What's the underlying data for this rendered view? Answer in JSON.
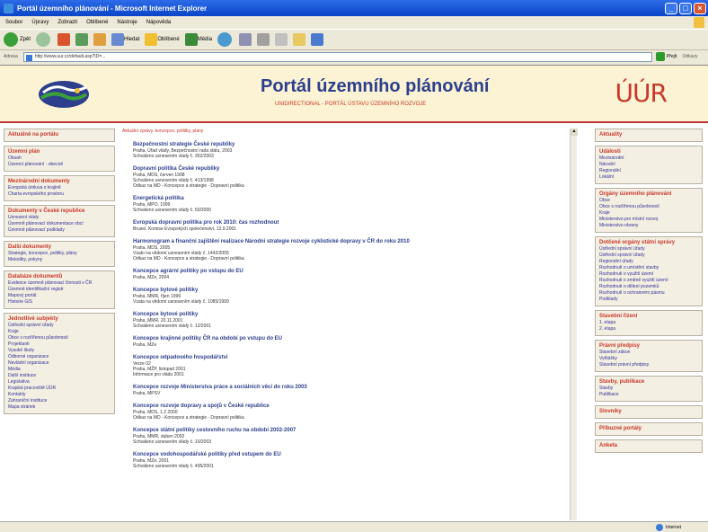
{
  "window": {
    "title": "Portál územního plánování - Microsoft Internet Explorer"
  },
  "menu": [
    "Soubor",
    "Úpravy",
    "Zobrazit",
    "Oblíbené",
    "Nástroje",
    "Nápověda"
  ],
  "toolbar": {
    "back": "Zpět",
    "search": "Hledat",
    "favorites": "Oblíbené",
    "media": "Média"
  },
  "address": {
    "label": "Adresa",
    "url": "http://www.uur.cz/default.asp?ID=...",
    "go": "Přejít",
    "links": "Odkazy"
  },
  "header": {
    "title": "Portál územního plánování",
    "subtitle": "UNIDIRECTIONAL - PORTÁL ÚSTAVU ÚZEMNÍHO ROZVOJE",
    "uur": "ÚÚR"
  },
  "left": [
    {
      "head": "Aktuálně na portálu",
      "items": []
    },
    {
      "head": "Územní plán",
      "items": [
        "Obsah",
        "Územní plánování - obecně"
      ]
    },
    {
      "head": "Mezinárodní dokumenty",
      "items": [
        "Evropská úmluva o krajině",
        "Charta evropského prostoru"
      ]
    },
    {
      "head": "Dokumenty v České republice",
      "items": [
        "Usnesení vlády",
        "Územně plánovací dokumentace obcí",
        "Územně plánovací podklady"
      ]
    },
    {
      "head": "Další dokumenty",
      "items": [
        "Strategie, koncepce, politiky, plány",
        "Metodiky, pokyny"
      ]
    },
    {
      "head": "Databáze dokumentů",
      "items": [
        "Evidence územně plánovací činnosti v ČR",
        "Územně identifikační registr",
        "Mapový portál",
        "Historie GIS"
      ]
    },
    {
      "head": "Jednotlivé subjekty",
      "items": [
        "Ústřední správní úřady",
        "Kraje",
        "Obce s rozšířenou působností",
        "Projektanti",
        "Vysoké školy",
        "Odborné organizace",
        "Nevládní organizace",
        "Média",
        "Další instituce",
        "Legislativa",
        "Krajská pracoviště ÚÚR",
        "Kontakty",
        "Zahraniční instituce",
        "Mapa stránek"
      ]
    }
  ],
  "breadcrumb": "Aktuální zprávy, koncepce, politiky, plány",
  "entries": [
    {
      "title": "Bezpečnostní strategie České republiky",
      "lines": [
        "Praha, Úřad vlády, Bezpečnostní rada státu, 2003",
        "Schváleno usnesením vlády č. 352/2003"
      ]
    },
    {
      "title": "Dopravní politika České republiky",
      "lines": [
        "Praha, MDS, červen 1998",
        "Schváleno usnesením vlády č. 413/1998",
        "Odkaz na MD - Koncepce a strategie - Dopravní politika"
      ]
    },
    {
      "title": "Energetická politika",
      "lines": [
        "Praha, MPO, 1999",
        "Schváleno usnesením vlády č. 50/2000"
      ]
    },
    {
      "title": "Evropská dopravní politika pro rok 2010: čas rozhodnout",
      "lines": [
        "Brusel, Komise Evropských společenství, 12.9.2001"
      ]
    },
    {
      "title": "Harmonogram a finanční zajištění realizace Národní strategie rozvoje cyklistické dopravy v ČR do roku 2010",
      "lines": [
        "Praha, MDS, 2005",
        "Vzato na vědomí usnesením vlády č. 1442/2005",
        "Odkaz na MD - Koncepce a strategie - Dopravní politika"
      ]
    },
    {
      "title": "Koncepce agrární politiky po vstupu do EU",
      "lines": [
        "Praha, MZe, 2004"
      ]
    },
    {
      "title": "Koncepce bytové politiky",
      "lines": [
        "Praha, MMR, říjen 1999",
        "Vzata na vědomí usnesením vlády č. 1085/1999"
      ]
    },
    {
      "title": "Koncepce bytové politiky",
      "lines": [
        "Praha, MMR, 20.11.2001",
        "Schváleno usnesením vlády č. 12/2001"
      ]
    },
    {
      "title": "Koncepce krajinné politiky ČR na období po vstupu do EU",
      "lines": [
        "Praha, MZe"
      ]
    },
    {
      "title": "Koncepce odpadového hospodářství",
      "lines": [
        "Verze 02",
        "Praha, MŽP, listopad 2001",
        "Informace pro vládu 2001"
      ]
    },
    {
      "title": "Koncepce rozvoje Ministerstva práce a sociálních věcí do roku 2003",
      "lines": [
        "Praha, MPSV"
      ]
    },
    {
      "title": "Koncepce rozvoje dopravy a spojů v České republice",
      "lines": [
        "Praha, MDS, 1.2.2000",
        "Odkaz na MD - Koncepce a strategie - Dopravní politika"
      ]
    },
    {
      "title": "Koncepce státní politiky cestovního ruchu na období 2002-2007",
      "lines": [
        "Praha, MMR, duben 2002",
        "Schváleno usnesením vlády č. 10/2003"
      ]
    },
    {
      "title": "Koncepce vodohospodářské politiky před vstupem do EU",
      "lines": [
        "Praha, MZe, 2001",
        "Schváleno usnesením vlády č. 495/2001"
      ]
    }
  ],
  "right": [
    {
      "head": "Aktuality",
      "items": []
    },
    {
      "head": "Události",
      "items": [
        "Mezinárodní",
        "Národní",
        "Regionální",
        "Lokální"
      ]
    },
    {
      "head": "Orgány územního plánování",
      "items": [
        "Obce",
        "Obce s rozšířenou působností",
        "Kraje",
        "Ministerstvo pro místní rozvoj",
        "Ministerstvo obrany"
      ]
    },
    {
      "head": "Dotčené orgány státní správy",
      "items": [
        "Ústřední správní úřady",
        "Ústřední správní úřady",
        "Regionální úřady",
        "Rozhodnutí o umístění stavby",
        "Rozhodnutí o využití území",
        "Rozhodnutí o změně využití území",
        "Rozhodnutí o dělení pozemků",
        "Rozhodnutí o ochranném pásmu",
        "Podklady"
      ]
    },
    {
      "head": "Stavební řízení",
      "items": [
        "1. etapa",
        "2. etapa"
      ]
    },
    {
      "head": "Právní předpisy",
      "items": [
        "Stavební zákon",
        "Vyhlášky",
        "Stavební právní předpisy"
      ]
    },
    {
      "head": "Stavby, publikace",
      "items": [
        "Stavby",
        "Publikace"
      ]
    },
    {
      "head": "Slovníky",
      "items": []
    },
    {
      "head": "Příbuzné portály",
      "items": []
    },
    {
      "head": "Anketa",
      "items": []
    }
  ],
  "status": {
    "zone": "Internet"
  },
  "colors": {
    "accent": "#c8372b",
    "link": "#2d3f8c",
    "header_bg": "#fbf3d4"
  }
}
